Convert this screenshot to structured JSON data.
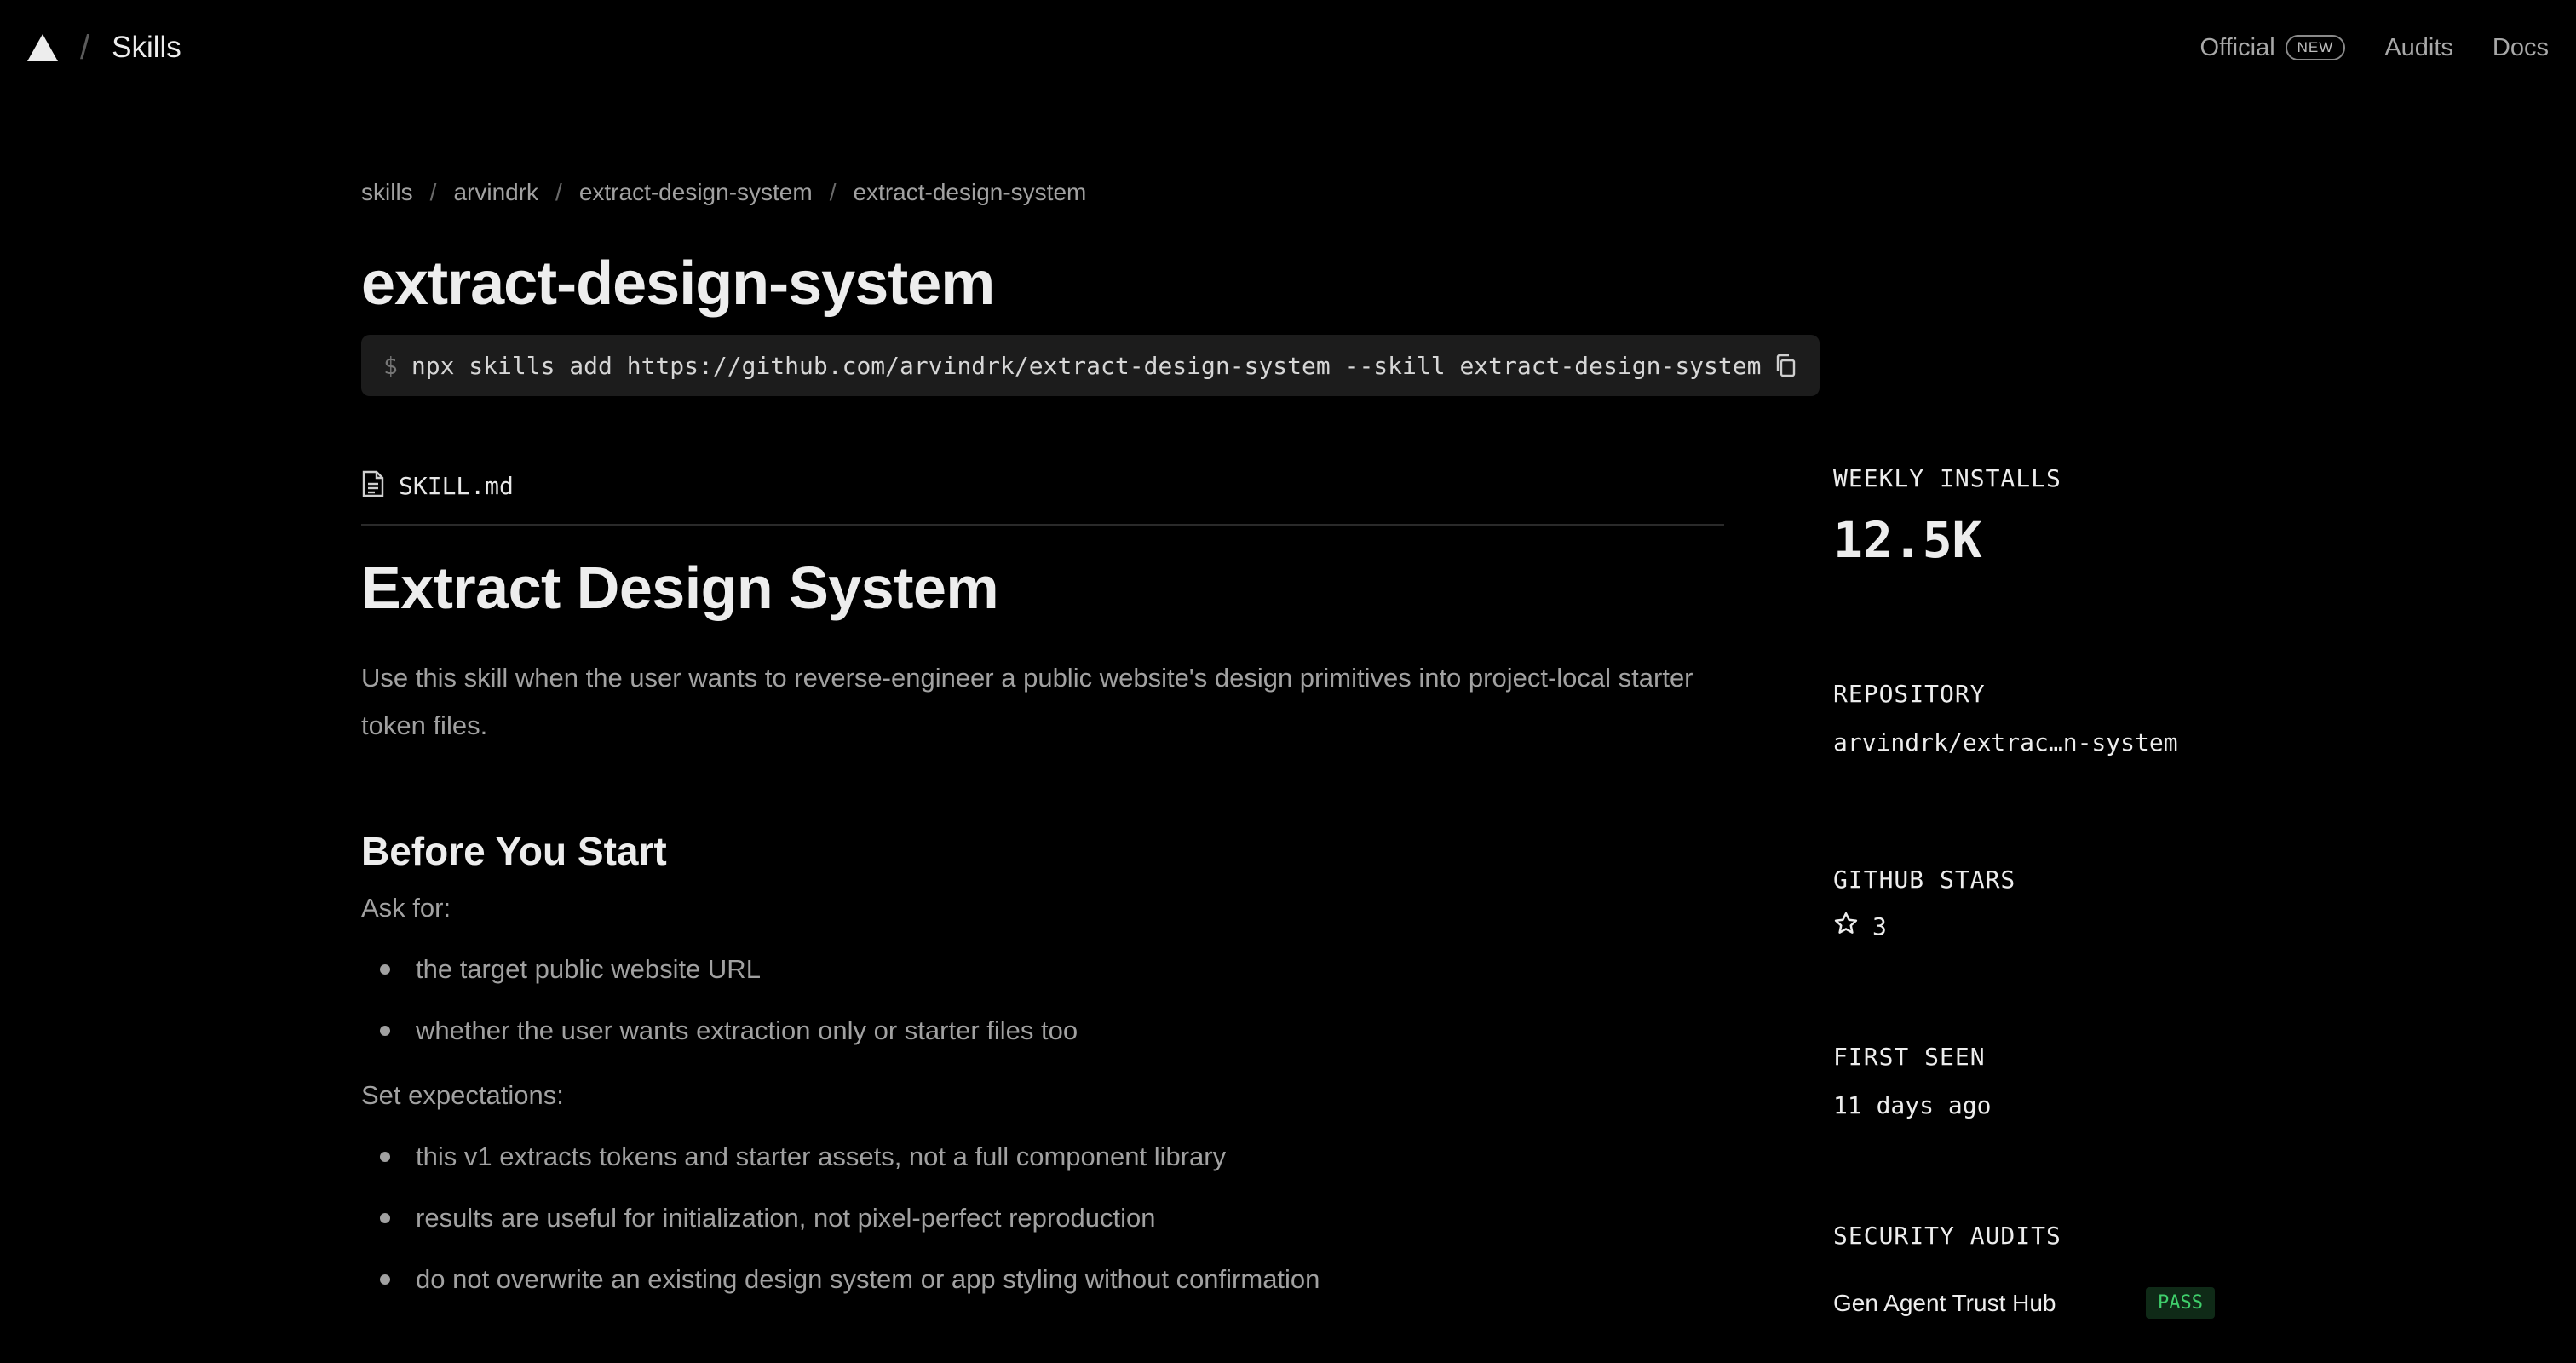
{
  "nav": {
    "brand": "Skills",
    "separator": "/",
    "links": [
      {
        "label": "Official",
        "badge": "NEW"
      },
      {
        "label": "Audits"
      },
      {
        "label": "Docs"
      }
    ]
  },
  "breadcrumb": [
    "skills",
    "arvindrk",
    "extract-design-system",
    "extract-design-system"
  ],
  "breadcrumb_separator": "/",
  "title": "extract-design-system",
  "command": {
    "prompt": "$",
    "text": "npx skills add https://github.com/arvindrk/extract-design-system --skill extract-design-system"
  },
  "file_tab": {
    "name": "SKILL.md"
  },
  "article": {
    "h1": "Extract Design System",
    "description": "Use this skill when the user wants to reverse-engineer a public website's design primitives into project-local starter token files.",
    "h2": "Before You Start",
    "ask_for": "Ask for:",
    "ask_items": [
      "the target public website URL",
      "whether the user wants extraction only or starter files too"
    ],
    "set_expectations": "Set expectations:",
    "expectation_items": [
      "this v1 extracts tokens and starter assets, not a full component library",
      "results are useful for initialization, not pixel-perfect reproduction",
      "do not overwrite an existing design system or app styling without confirmation"
    ]
  },
  "sidebar": {
    "weekly_installs_label": "WEEKLY INSTALLS",
    "weekly_installs_value": "12.5K",
    "repository_label": "REPOSITORY",
    "repository_value": "arvindrk/extrac…n-system",
    "github_stars_label": "GITHUB STARS",
    "github_stars_value": "3",
    "first_seen_label": "FIRST SEEN",
    "first_seen_value": "11 days ago",
    "security_audits_label": "SECURITY AUDITS",
    "audits": [
      {
        "name": "Gen Agent Trust Hub",
        "status": "PASS"
      }
    ]
  },
  "colors": {
    "background": "#000000",
    "text": "#ededed",
    "muted": "#a1a1a1",
    "code_bg": "#1c1c1c",
    "pass": "#3fcf6b"
  }
}
